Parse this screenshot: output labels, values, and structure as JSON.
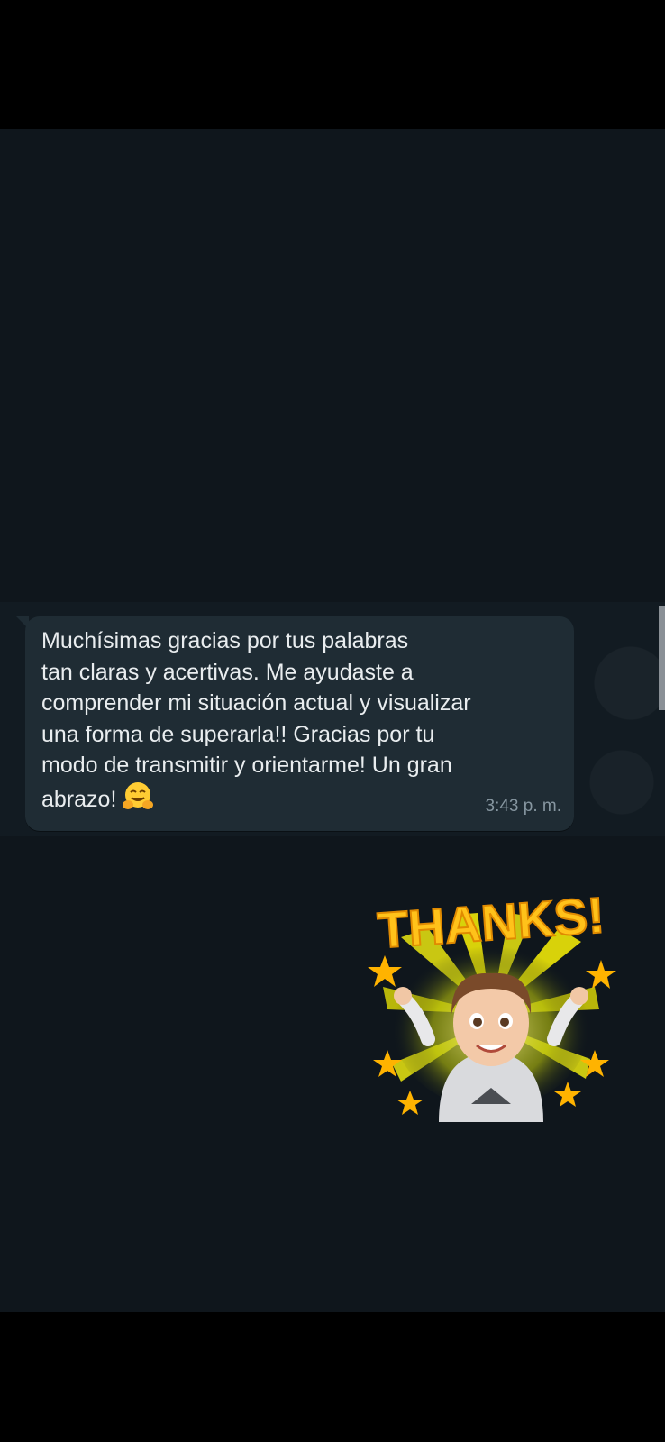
{
  "message": {
    "lines": [
      "Muchísimas gracias por tus palabras",
      "tan claras y acertivas. Me ayudaste a",
      "comprender mi situación actual y visualizar",
      "una forma de superarla!! Gracias por tu",
      "modo de transmitir y orientarme! Un gran",
      "abrazo!"
    ],
    "emoji": "hugging-face",
    "time": "3:43 p. m."
  },
  "sticker": {
    "text": "THANKS!",
    "icon": "avatar-thanks-sticker",
    "colors": {
      "letters": "#ffc21a",
      "stars": "#ffb300",
      "rays": "#d8d20a"
    }
  },
  "colors": {
    "chat_bg": "#0f161c",
    "bubble_bg": "#1f2c34",
    "text": "#e9edef",
    "meta": "#8696a0"
  }
}
